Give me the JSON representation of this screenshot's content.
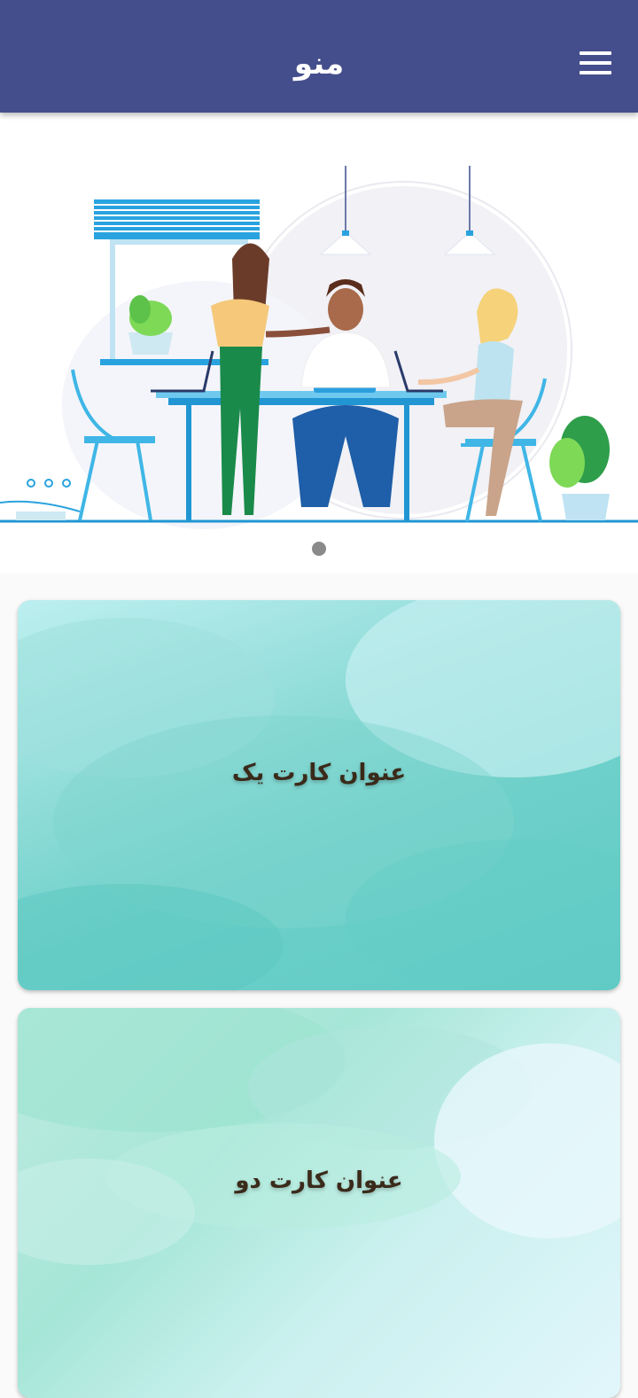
{
  "appbar": {
    "title": "منو",
    "menu_icon": "hamburger-menu-icon",
    "background": "#454e8c"
  },
  "slider": {
    "image": "office-team-illustration",
    "page_indicator_count": 1
  },
  "cards": [
    {
      "title": "عنوان کارت یک",
      "background": "teal-watercolor"
    },
    {
      "title": "عنوان کارت دو",
      "background": "mint-watercolor"
    }
  ]
}
